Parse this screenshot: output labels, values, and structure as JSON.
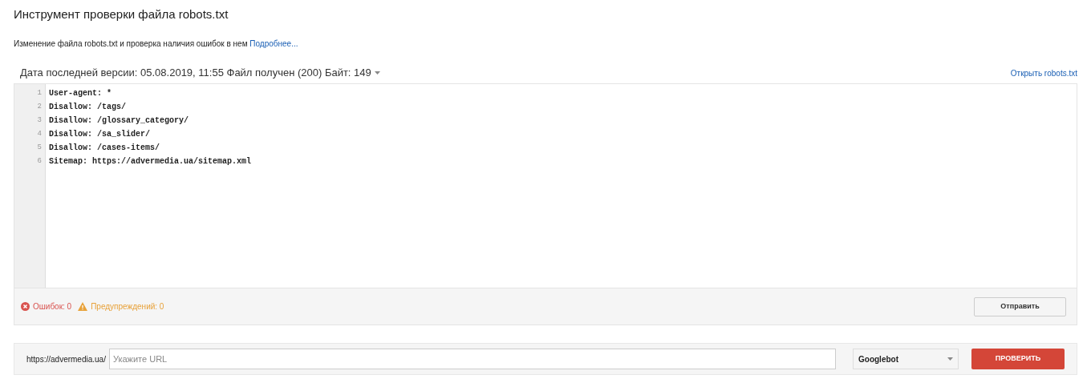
{
  "title": "Инструмент проверки файла robots.txt",
  "description": {
    "text": "Изменение файла robots.txt и проверка наличия ошибок в нем",
    "link": "Подробнее..."
  },
  "version_info": "Дата последней версии: 05.08.2019, 11:55 Файл получен (200) Байт: 149",
  "open_link": "Открыть robots.txt",
  "editor": {
    "lines": [
      {
        "number": "1",
        "text": "User-agent: *"
      },
      {
        "number": "2",
        "text": "Disallow: /tags/"
      },
      {
        "number": "3",
        "text": "Disallow: /glossary_category/"
      },
      {
        "number": "4",
        "text": "Disallow: /sa_slider/"
      },
      {
        "number": "5",
        "text": "Disallow: /cases-items/"
      },
      {
        "number": "6",
        "text": "Sitemap: https://advermedia.ua/sitemap.xml"
      }
    ]
  },
  "status": {
    "errors": "Ошибок: 0",
    "warnings": "Предупреждений: 0",
    "submit_button": "Отправить"
  },
  "test_bar": {
    "prefix": "https://advermedia.ua/",
    "url_placeholder": "Укажите URL",
    "agent": "Googlebot",
    "check_button": "ПРОВЕРИТЬ"
  }
}
